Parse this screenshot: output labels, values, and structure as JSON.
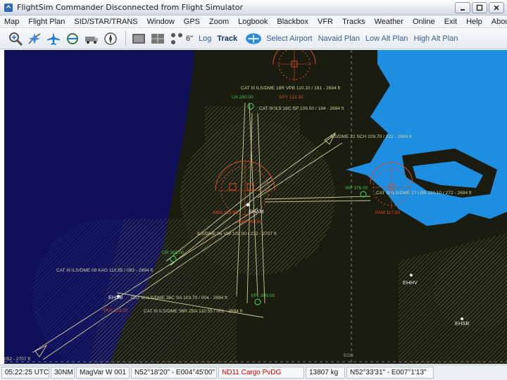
{
  "window": {
    "title": "FlightSim Commander Disconnected from Flight Simulator"
  },
  "menu": [
    "Map",
    "Flight Plan",
    "SID/STAR/TRANS",
    "Window",
    "GPS",
    "Zoom",
    "Logbook",
    "Blackbox",
    "VFR",
    "Tracks",
    "Weather",
    "Online",
    "Exit",
    "Help",
    "About"
  ],
  "toolbar": {
    "icon_names": [
      "airport-search-icon",
      "flightplan-icon",
      "aircraft-icon",
      "route-icon",
      "vehicle-icon",
      "compass-icon",
      "map-view-icon",
      "grid-view-icon",
      "radar-icon"
    ],
    "gps_readout": "6\"",
    "log_label": "Log",
    "track_label": "Track",
    "select_airport_label": "Select Airport",
    "navaid_plan_label": "Navaid Plan",
    "low_alt_plan_label": "Low Alt Plan",
    "high_alt_plan_label": "High Alt Plan"
  },
  "map": {
    "colors": {
      "land": "#1a1c10",
      "sea": "#0f0f54",
      "water": "#1e8ee0",
      "hatch": "#7a7a58",
      "ils": "#cfcf9a",
      "vor": "#d84a2a",
      "navaid": "#3fc04a"
    },
    "labels": {
      "ils_18r": "CAT III ILS/DME 18R VPB 110.10 / 181 - 2694 ft",
      "ua": "UA 280.00",
      "spy": "SPY 113.30",
      "ils_18c": "CAT III ILS 18C SP 109.50 / 184 - 2694 ft",
      "ils_22": "ILS/DME 22 SCH 109.70 / 222 - 2694 ft",
      "ams": "AMS 113.95",
      "eham": "EHAM",
      "ams_freq": "AMS 385.00",
      "wp": "WP 376.00",
      "ils_27": "CAT III ILS/DME 27 LBB 110.10 / 272 - 2694 ft",
      "pam": "PAM 117.80",
      "ils_06": "ILS/DME 06 VW 109.00 / 232 - 2707 ft",
      "cr": "CR 355.00",
      "ils_09": "CAT III ILS/DME 09 KAG 110.55 / 083 - 2694 ft",
      "ehhv": "EHHV",
      "ehsb": "EHSB",
      "ils_36c": "CAT III ILS/DME 36C SA 103.70 / 004 - 2694 ft",
      "ehsb2": "EHSB",
      "ykg": "YKG 113.20",
      "ils_36r": "CAT III ILS/DME 36R ZBA 110.55 / 001 - 2694 ft",
      "spl": "SPL 395.00",
      "ils_bottom": "052 - 2707 ft",
      "eos": "EOS"
    }
  },
  "status": {
    "time": "05:22:25 UTC",
    "range": "30NM",
    "mode": "MagVar W 001",
    "position": "N52°18'20\" - E004°45'00\"",
    "alert": "ND11 Cargo PvDG",
    "altitude": "13807 kg",
    "cursor": "N52°33'31\" - E007°1'13\""
  }
}
